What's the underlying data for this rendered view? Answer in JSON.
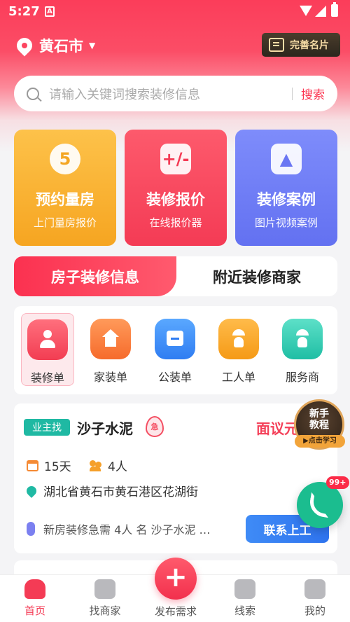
{
  "status": {
    "time": "5:27",
    "sim_label": "A"
  },
  "header": {
    "city": "黄石市",
    "card_button": "完善名片"
  },
  "search": {
    "placeholder": "请输入关键词搜索装修信息",
    "button": "搜索"
  },
  "tiles": [
    {
      "title": "预约量房",
      "subtitle": "上门量房报价",
      "glyph": "5"
    },
    {
      "title": "装修报价",
      "subtitle": "在线报价器",
      "glyph": "+/-"
    },
    {
      "title": "装修案例",
      "subtitle": "图片视频案例",
      "glyph": "▲"
    }
  ],
  "tabs": {
    "active": "房子装修信息",
    "other": "附近装修商家"
  },
  "categories": [
    {
      "label": "装修单",
      "icon": "person-icon"
    },
    {
      "label": "家装单",
      "icon": "house-icon"
    },
    {
      "label": "公装单",
      "icon": "shop-icon"
    },
    {
      "label": "工人单",
      "icon": "worker-icon"
    },
    {
      "label": "服务商",
      "icon": "engineer-icon"
    }
  ],
  "job": {
    "badge": "业主找",
    "title": "沙子水泥",
    "urgent": "急",
    "price": "面议元",
    "days": "15天",
    "people": "4人",
    "address": "湖北省黄石市黄石港区花湖街",
    "description": "新房装修急需 4人 名 沙子水泥 …",
    "contact_button": "联系上工"
  },
  "tutorial": {
    "title_line1": "新手",
    "title_line2": "教程",
    "badge": "▶点击学习"
  },
  "notification_count": "99+",
  "nav": {
    "home": "首页",
    "merchants": "找商家",
    "publish": "发布需求",
    "leads": "线索",
    "mine": "我的"
  },
  "colors": {
    "brand": "#f43b55",
    "accent_blue": "#2e73ee",
    "teal": "#1fb9a3"
  }
}
